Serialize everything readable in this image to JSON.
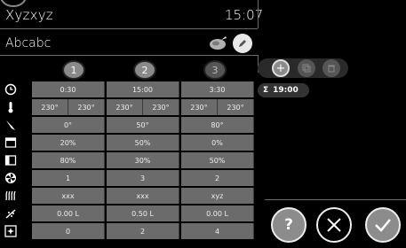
{
  "header": {
    "title": "Xyzxyz",
    "time": "15:07"
  },
  "program": {
    "name": "Abcabc"
  },
  "steps": [
    "1",
    "2",
    "3"
  ],
  "summary": {
    "symbol": "Σ",
    "total": "19:00"
  },
  "rows": {
    "time": [
      "0:30",
      "15:00",
      "3:30"
    ],
    "temperature": [
      "230°",
      "230°",
      "230°",
      "230°",
      "230°",
      "230°"
    ],
    "core": [
      "0°",
      "50°",
      "80°"
    ],
    "humidity": [
      "20%",
      "50%",
      "0%"
    ],
    "vent": [
      "80%",
      "30%",
      "50%"
    ],
    "fan": [
      "1",
      "3",
      "2"
    ],
    "mode": [
      "xxx",
      "xxx",
      "xyz"
    ],
    "water": [
      "0.00 L",
      "0.50 L",
      "0.00 L"
    ],
    "extra": [
      "0",
      "2",
      "4"
    ]
  },
  "icons": [
    "clock-icon",
    "thermometer-icon",
    "core-probe-icon",
    "humidity-icon",
    "vent-icon",
    "fan-icon",
    "heating-icon",
    "water-spray-icon",
    "special-mode-icon"
  ],
  "colors": {
    "cell": "#6b6b6b",
    "accent": "#8c8c8c"
  }
}
